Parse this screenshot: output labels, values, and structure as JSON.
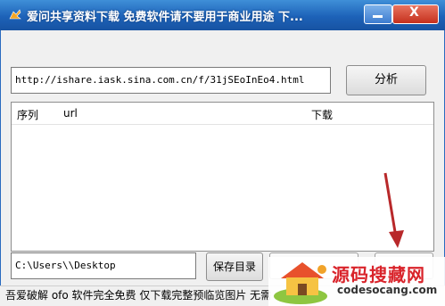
{
  "window": {
    "title": "爱问共享资料下载 免费软件请不要用于商业用途 下...",
    "minimize_label": "minimize",
    "close_label": "X"
  },
  "form": {
    "url_value": "http://ishare.iask.sina.com.cn/f/31jSEoInEo4.html",
    "analyze_label": "分析"
  },
  "list": {
    "columns": [
      "序列",
      "url",
      "下载"
    ]
  },
  "save": {
    "path_value": "C:\\Users\\\\Desktop",
    "save_dir_label": "保存目录"
  },
  "status": {
    "text": "吾爱破解 ofo 软件完全免费 仅下载完整预临览图片 无需"
  },
  "watermark": {
    "title": "源码搜藏网",
    "url": "codesocang.com"
  },
  "colors": {
    "titlebar": "#1d62b8",
    "arrow": "#b8282a",
    "watermark_red": "#d9232a"
  },
  "icons": {
    "app": "hand-icon",
    "arrow": "red-arrow-icon",
    "watermark": "house-icon"
  }
}
